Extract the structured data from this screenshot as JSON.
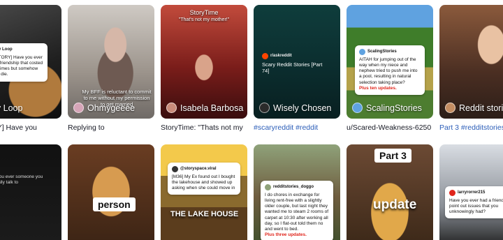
{
  "row1": [
    {
      "thumb_title": "Story Loop",
      "caption": "[STORY] Have you",
      "overlay": "[FULL STORY] Have you ever ended a friendship that costed you two times but somehow refuse to die.",
      "color": "#d9b38c"
    },
    {
      "thumb_title": "Ohmygeeee",
      "caption": "Replying to",
      "overlay": "My BFF is reluctant to commit to me without my permission to get married",
      "color": "#d6a5b8"
    },
    {
      "thumb_title": "Isabela Barbosa",
      "caption": "StoryTime: \"Thats not my",
      "overlay": "StoryTime",
      "overlay2": "\"That's not my mother!\"",
      "color": "#c98a7a"
    },
    {
      "thumb_title": "Wisely Chosen",
      "caption": "#scaryreddit #reddit",
      "overlay": "Scary Reddit Stories [Part 74]",
      "overlay_user": "r/askreddit",
      "color": "#2b2b2b"
    },
    {
      "thumb_title": "ScalingStories",
      "caption": "u/Scared-Weakness-6250",
      "overlay": "AITAH for jumping out of the way when my niece and nephew tried to push me into a pool, resulting in natural selection taking place?",
      "overlay_user": "ScalingStories",
      "overlay_update": "Plus ten updates.",
      "color": "#5fa2e0"
    },
    {
      "thumb_title": "Reddit stories",
      "caption": "Part 3 #redditstories #",
      "color": "#c48d62"
    }
  ],
  "row2": [
    {
      "overlay": "I have you ever someone you can't really talk to",
      "color": "#222"
    },
    {
      "overlay": "person",
      "color": "#d79b50"
    },
    {
      "overlay_user": "@storyspace.viral",
      "overlay": "[M36] My Ex found out I bought the lakehouse and showed up asking when she could move in",
      "overlay2": "THE LAKE HOUSE",
      "color": "#f3c94b"
    },
    {
      "overlay_user": "redditstories_doggo",
      "overlay": "I do chores in exchange for living rent-free with a slightly older couple, but last night they wanted me to steam 2 rooms of carpet at 10:30 after working all day, so I flat-out told them no and went to bed.",
      "overlay_update": "Plus three updates.",
      "color": "#8fa27a"
    },
    {
      "overlay": "update",
      "overlay2": "Part 3",
      "color": "#e1a84a"
    },
    {
      "overlay_user": "larryrorrer215",
      "overlay": "Have you ever had a friend point out issues that you unknowingly had?",
      "color": "#8a8f96"
    }
  ]
}
